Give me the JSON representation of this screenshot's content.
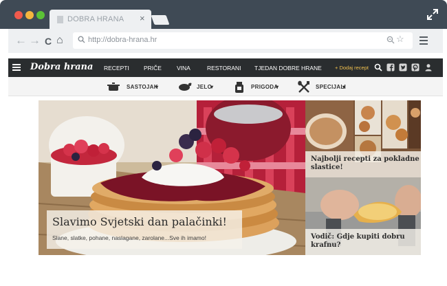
{
  "browser": {
    "tab_title": "DOBRA HRANA",
    "tab_close": "×",
    "url": "http://dobra-hrana.hr",
    "back_glyph": "←",
    "forward_glyph": "→",
    "reload_glyph": "C",
    "home_glyph": "⌂",
    "star_glyph": "☆",
    "traffic_light_colors": [
      "#f15a4c",
      "#f5b53e",
      "#5bc236"
    ]
  },
  "site": {
    "logo": "Dobra hrana",
    "nav_items": [
      "RECEPTI",
      "PRIČE",
      "VINA",
      "RESTORANI",
      "TJEDAN DOBRE HRANE"
    ],
    "add_recipe": "+ Dodaj recept",
    "nav_icons": [
      "search-icon",
      "facebook-icon",
      "twitter-icon",
      "pinterest-icon",
      "user-icon"
    ],
    "accent_color": "#f2c14e"
  },
  "categories": [
    {
      "label": "SASTOJAK",
      "arrow": "▾",
      "icon": "pot-icon"
    },
    {
      "label": "JELO",
      "arrow": "▾",
      "icon": "roast-chicken-icon"
    },
    {
      "label": "PRIGODA",
      "arrow": "▾",
      "icon": "gift-jar-icon"
    },
    {
      "label": "SPECIJALI",
      "arrow": "▾",
      "icon": "crossed-utensils-icon"
    }
  ],
  "hero": {
    "title": "Slavimo Svjetski dan palačinki!",
    "subtitle": "Slane, slatke, pohane, naslagane, zarolane...Sve ih imamo!"
  },
  "side_cards": [
    {
      "title": "Najbolji recepti za pokladne slastice!"
    },
    {
      "title": "Vodič: Gdje kupiti dobru krafnu?"
    }
  ]
}
